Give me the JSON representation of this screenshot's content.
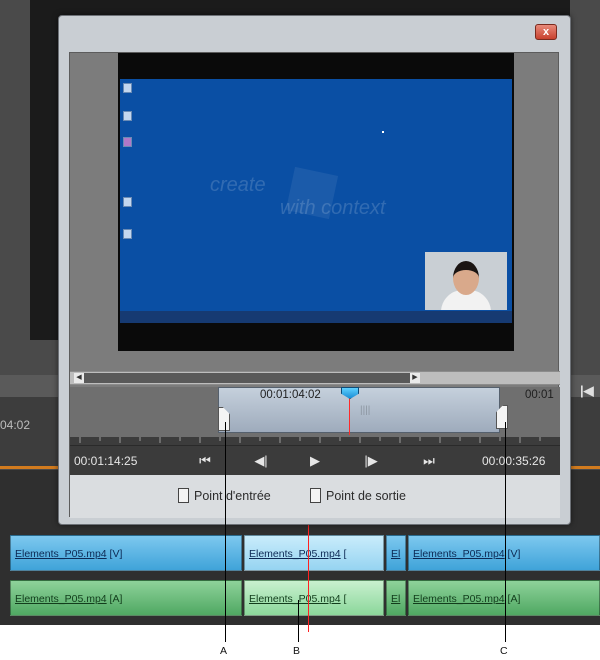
{
  "background": {
    "timecode_left": "04:02",
    "timecode_right_cut": "00:01",
    "timeline_clips": {
      "video": [
        {
          "name": "Elements_P05.mp4",
          "suffix": " [V]"
        },
        {
          "name": "Elements_P05.mp4",
          "suffix": " ["
        },
        {
          "name": "El",
          "suffix": ""
        },
        {
          "name": "Elements_P05.mp4",
          "suffix": " [V]"
        }
      ],
      "audio": [
        {
          "name": "Elements_P05.mp4",
          "suffix": " [A]"
        },
        {
          "name": "Elements_P05.mp4",
          "suffix": " ["
        },
        {
          "name": "El",
          "suffix": ""
        },
        {
          "name": "Elements_P05.mp4",
          "suffix": " [A]"
        }
      ]
    }
  },
  "dialog": {
    "close_label": "x",
    "preview": {
      "watermark_line1": "create",
      "watermark_line2": "with context"
    },
    "trim": {
      "current_timecode": "00:01:04:02",
      "right_timecode": "00:01",
      "grip": "||||"
    },
    "controls": {
      "in_timecode": "00:01:14:25",
      "out_timecode": "00:00:35:26",
      "go_to_in_icon": "⏮",
      "step_back_icon": "◀|",
      "play_icon": "▶",
      "step_forward_icon": "|▶",
      "go_to_out_icon": "⏭"
    },
    "in_point_label": "Point d'entrée",
    "out_point_label": "Point de sortie"
  },
  "callouts": {
    "a": "A",
    "b": "B",
    "c": "C"
  },
  "colors": {
    "video_clip": "#3fa3d9",
    "audio_clip": "#4fa862",
    "playhead": "#ff2222",
    "timeline_accent": "#d27b1e",
    "desktop_blue": "#0a4fa4"
  }
}
